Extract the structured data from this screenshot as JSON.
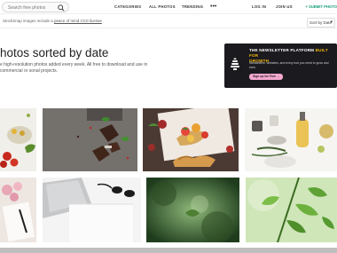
{
  "search": {
    "placeholder": "Search free photos"
  },
  "nav": {
    "categories": "CATEGORIES",
    "all_photos": "ALL PHOTOS",
    "trending": "TRENDING",
    "more": "•••",
    "login": "LOG IN",
    "join": "JOIN US",
    "submit": "+ SUBMIT PHOTO"
  },
  "license": {
    "prefix": "StockSnap images include a ",
    "link": "peace of mind CC0 license",
    "sort": "Sort by Date"
  },
  "main": {
    "title": "hotos sorted by date",
    "description": "e high-resolution photos added every week. All free to download and use in commercial or sonal projects."
  },
  "ad": {
    "title_a": "THE NEWSLETTER PLATFORM",
    "title_b": "BUILT FOR",
    "title_c": "GROWTH",
    "body": "Newsletters, websites, and every tool you need to grow and earn.",
    "cta": "Sign up for Free →"
  },
  "colors": {
    "accent": "#1a9e7a",
    "ad_bg": "#1b1b1f",
    "ad_highlight": "#f5b80a",
    "cta_bg": "#f5a8d0"
  },
  "photos": [
    {
      "subject": "tomatoes-salad-icon"
    },
    {
      "subject": "chocolate-mint-icon"
    },
    {
      "subject": "bruschetta-bread-icon"
    },
    {
      "subject": "salt-rosemary-oil-icon"
    },
    {
      "subject": "roses-notebook-icon"
    },
    {
      "subject": "laptop-sunglasses-icon"
    },
    {
      "subject": "green-bokeh-plant-icon"
    },
    {
      "subject": "green-leaves-icon"
    }
  ]
}
